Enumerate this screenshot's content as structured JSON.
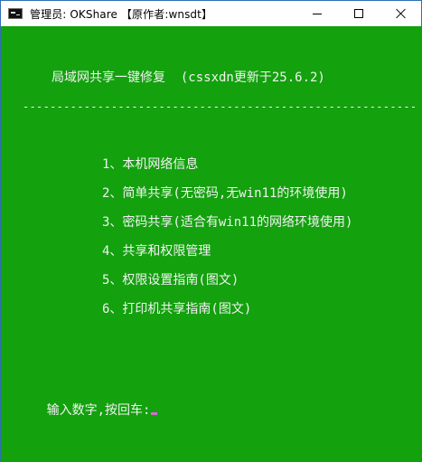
{
  "window": {
    "title": "管理员:  OKShare  【原作者:wnsdt】"
  },
  "console": {
    "header": "局域网共享一键修复  (cssxdn更新于25.6.2)",
    "separator": "----------------------------------------------------------",
    "menu": [
      "1、本机网络信息",
      "2、简单共享(无密码,无win11的环境使用)",
      "3、密码共享(适合有win11的网络环境使用)",
      "4、共享和权限管理",
      "5、权限设置指南(图文)",
      "6、打印机共享指南(图文)"
    ],
    "prompt": "输入数字,按回车:"
  },
  "icons": {
    "app": "console-app-icon",
    "minimize": "minimize-icon",
    "maximize": "maximize-icon",
    "close": "close-icon"
  },
  "colors": {
    "console_background": "#13a10e",
    "console_text": "#f2f2f2",
    "titlebar_background": "#ffffff",
    "cursor": "#d66bd6"
  }
}
